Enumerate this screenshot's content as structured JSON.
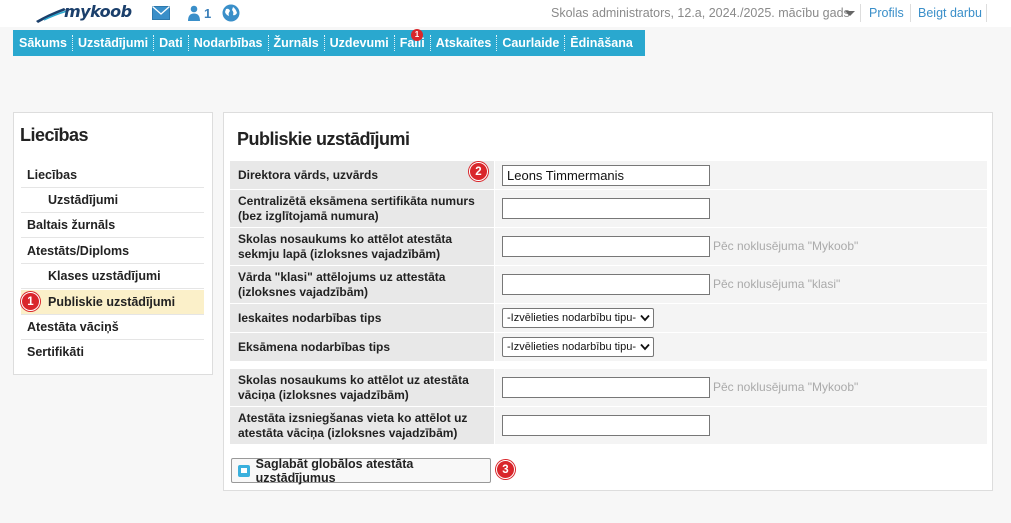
{
  "header": {
    "logo_text": "mykoob",
    "user_count": "1",
    "context": "Skolas administrators, 12.a, 2024./2025. mācību gads",
    "links": [
      "Profils",
      "Beigt darbu"
    ]
  },
  "nav": {
    "items": [
      "Sākums",
      "Uzstādījumi",
      "Dati",
      "Nodarbības",
      "Žurnāls",
      "Uzdevumi",
      "Faili",
      "Atskaites",
      "Caurlaide",
      "Ēdināšana"
    ],
    "files_badge": "1"
  },
  "sidebar": {
    "title": "Liecības",
    "items": [
      {
        "label": "Liecības"
      },
      {
        "label": "Uzstādījumi"
      },
      {
        "label": "Baltais žurnāls"
      },
      {
        "label": "Atestāts/Diploms"
      },
      {
        "label": "Klases uzstādījumi"
      },
      {
        "label": "Publiskie uzstādījumi"
      },
      {
        "label": "Atestāta vāciņš"
      },
      {
        "label": "Sertifikāti"
      }
    ]
  },
  "markers": [
    "1",
    "2",
    "3"
  ],
  "form": {
    "title": "Publiskie uzstādījumi",
    "rows": [
      {
        "label": "Direktora vārds, uzvārds",
        "value": "Leons Timmermanis",
        "hint": ""
      },
      {
        "label": "Centralizētā eksāmena sertifikāta numurs (bez izglītojamā numura)",
        "value": "",
        "hint": ""
      },
      {
        "label": "Skolas nosaukums ko attēlot atestāta sekmju lapā (izloksnes vajadzībām)",
        "value": "",
        "hint": "Pēc noklusējuma \"Mykoob\""
      },
      {
        "label": "Vārda \"klasi\" attēlojums uz attestāta (izloksnes vajadzībām)",
        "value": "",
        "hint": "Pēc noklusējuma \"klasi\""
      },
      {
        "label": "Ieskaites nodarbības tips",
        "select": "-Izvēlieties nodarbību tipu-"
      },
      {
        "label": "Eksāmena nodarbības tips",
        "select": "-Izvēlieties nodarbību tipu-"
      },
      {
        "label": "Skolas nosaukums ko attēlot uz atestāta vāciņa (izloksnes vajadzībām)",
        "value": "",
        "hint": "Pēc noklusējuma \"Mykoob\""
      },
      {
        "label": "Atestāta izsniegšanas vieta ko attēlot uz atestāta vāciņa (izloksnes vajadzībām)",
        "value": "",
        "hint": ""
      }
    ],
    "save_label": "Saglabāt globālos atestāta uzstādījumus"
  },
  "colors": {
    "nav_bg": "#2aa8cf",
    "active_item": "#fbf0c9",
    "marker": "#d9262b"
  }
}
